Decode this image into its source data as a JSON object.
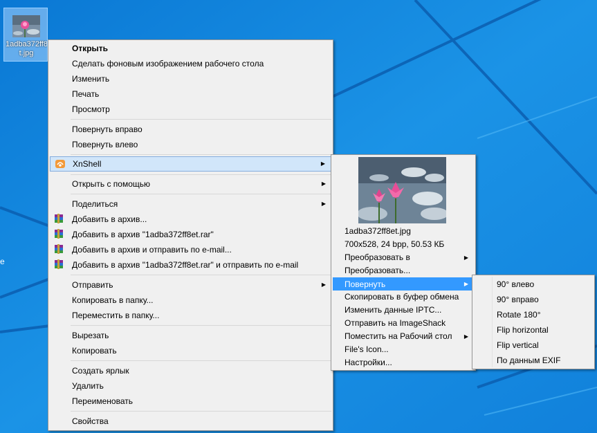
{
  "desktop": {
    "icon_label_line1": "1adba372ff8",
    "icon_label_line2": "t.jpg",
    "left_edge_char": "e"
  },
  "context_menu": {
    "open": "Открыть",
    "set_wallpaper": "Сделать фоновым изображением рабочего стола",
    "edit": "Изменить",
    "print": "Печать",
    "preview": "Просмотр",
    "rotate_right": "Повернуть вправо",
    "rotate_left": "Повернуть влево",
    "xnshell": "XnShell",
    "open_with": "Открыть с помощью",
    "share": "Поделиться",
    "add_archive": "Добавить в архив...",
    "add_archive_rar": "Добавить в архив \"1adba372ff8et.rar\"",
    "add_archive_email": "Добавить в архив и отправить по e-mail...",
    "add_archive_rar_email": "Добавить в архив \"1adba372ff8et.rar\" и отправить по e-mail",
    "send_to": "Отправить",
    "copy_to": "Копировать в папку...",
    "move_to": "Переместить в папку...",
    "cut": "Вырезать",
    "copy": "Копировать",
    "create_shortcut": "Создать ярлык",
    "delete": "Удалить",
    "rename": "Переименовать",
    "properties": "Свойства"
  },
  "xnshell_menu": {
    "filename": "1adba372ff8et.jpg",
    "info": "700x528, 24 bpp, 50.53 КБ",
    "convert_to": "Преобразовать в",
    "convert": "Преобразовать...",
    "rotate": "Повернуть",
    "copy_clipboard": "Скопировать в буфер обмена",
    "edit_iptc": "Изменить данные IPTC...",
    "send_imageshack": "Отправить на ImageShack",
    "place_desktop": "Поместить на Рабочий стол",
    "files_icon": "File's Icon...",
    "settings": "Настройки..."
  },
  "rotate_menu": {
    "rot90_left": "90° влево",
    "rot90_right": "90° вправо",
    "rot180": "Rotate 180°",
    "flip_h": "Flip horizontal",
    "flip_v": "Flip vertical",
    "by_exif": "По данным EXIF"
  },
  "colors": {
    "desktop_bg": "#1c8fe0",
    "highlight": "#3399ff",
    "menu_bg": "#f0f0f0"
  },
  "icons": [
    "image-file-icon",
    "xnshell-icon",
    "winrar-icon",
    "submenu-arrow-icon"
  ]
}
